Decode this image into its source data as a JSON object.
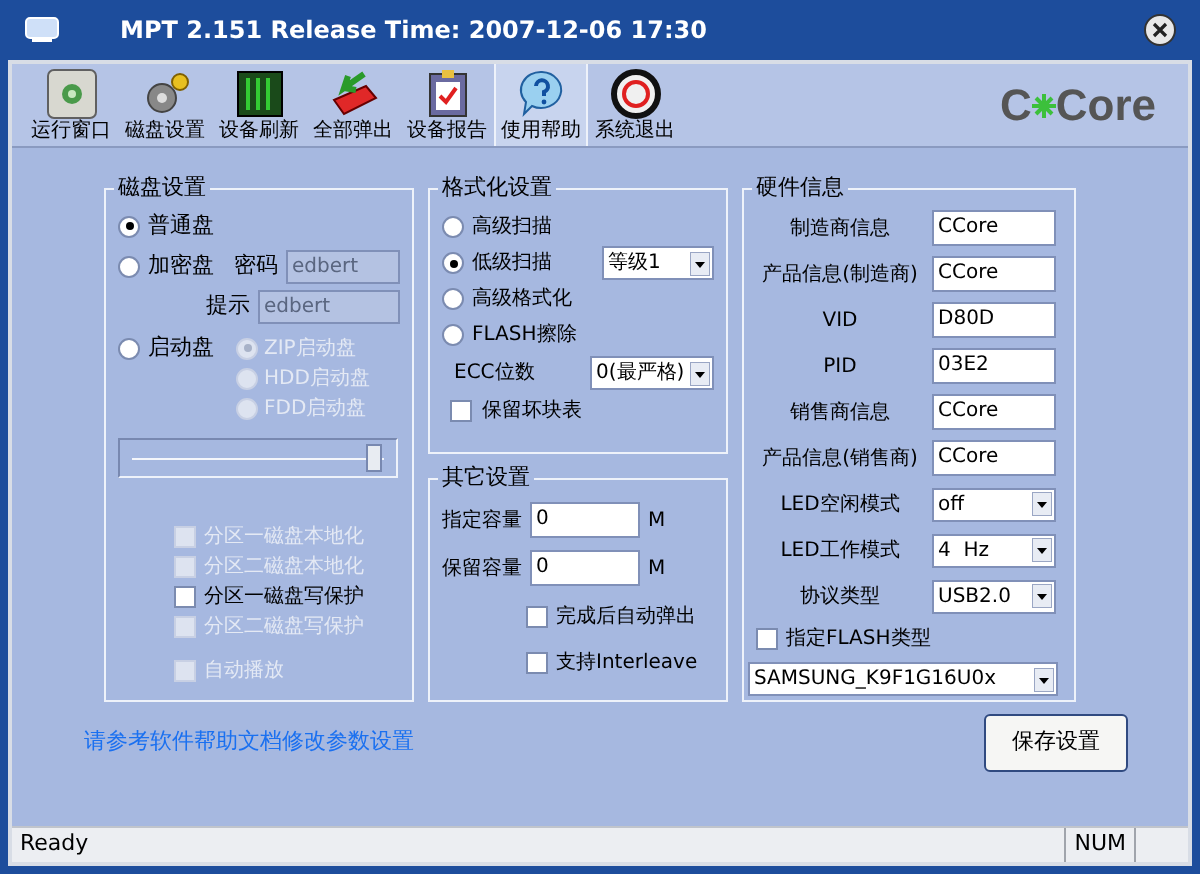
{
  "window": {
    "title": "MPT 2.151 Release Time: 2007-12-06 17:30"
  },
  "toolbar": {
    "items": [
      {
        "label": "运行窗口",
        "selected": false
      },
      {
        "label": "磁盘设置",
        "selected": false
      },
      {
        "label": "设备刷新",
        "selected": false
      },
      {
        "label": "全部弹出",
        "selected": false
      },
      {
        "label": "设备报告",
        "selected": false
      },
      {
        "label": "使用帮助",
        "selected": true
      },
      {
        "label": "系统退出",
        "selected": false
      }
    ]
  },
  "logo": {
    "part_1": "C",
    "part_2": "Core"
  },
  "disk_settings": {
    "title": "磁盘设置",
    "disk_types": [
      {
        "label": "普通盘",
        "selected": true
      },
      {
        "label": "加密盘",
        "selected": false
      }
    ],
    "password": {
      "label": "密码",
      "value": "edbert",
      "disabled": true
    },
    "hint": {
      "label": "提示",
      "value": "edbert",
      "disabled": true
    },
    "boot": {
      "label": "启动盘",
      "selected": false
    },
    "boot_types": [
      {
        "label": "ZIP启动盘",
        "selected": true,
        "disabled": true
      },
      {
        "label": "HDD启动盘",
        "selected": false,
        "disabled": true
      },
      {
        "label": "FDD启动盘",
        "selected": false,
        "disabled": true
      }
    ],
    "slider": {
      "level": 0.95
    },
    "checkboxes": [
      {
        "label": "分区一磁盘本地化",
        "checked": false,
        "disabled": true
      },
      {
        "label": "分区二磁盘本地化",
        "checked": false,
        "disabled": true
      },
      {
        "label": "分区一磁盘写保护",
        "checked": false,
        "disabled": false
      },
      {
        "label": "分区二磁盘写保护",
        "checked": false,
        "disabled": true
      }
    ],
    "autoplay": {
      "label": "自动播放",
      "checked": false,
      "disabled": true
    }
  },
  "format_settings": {
    "title": "格式化设置",
    "options": [
      {
        "label": "高级扫描",
        "selected": false
      },
      {
        "label": "低级扫描",
        "selected": true,
        "select": "等级1"
      },
      {
        "label": "高级格式化",
        "selected": false
      },
      {
        "label": "FLASH擦除",
        "selected": false
      }
    ],
    "ecc": {
      "label": "ECC位数",
      "value": "0(最严格)"
    },
    "keep_bad_blocks": {
      "label": "保留坏块表",
      "checked": false
    }
  },
  "other_settings": {
    "title": "其它设置",
    "fields": [
      {
        "label": "指定容量",
        "value": "0",
        "unit": "M"
      },
      {
        "label": "保留容量",
        "value": "0",
        "unit": "M"
      }
    ],
    "checkboxes": [
      {
        "label": "完成后自动弹出",
        "checked": false
      },
      {
        "label": "支持Interleave",
        "checked": false
      }
    ]
  },
  "hardware_info": {
    "title": "硬件信息",
    "fields": [
      {
        "kind": "text",
        "label": "制造商信息",
        "value": "CCore"
      },
      {
        "kind": "text",
        "label": "产品信息(制造商)",
        "value": "CCore"
      },
      {
        "kind": "text",
        "label": "VID",
        "value": "D80D"
      },
      {
        "kind": "text",
        "label": "PID",
        "value": "03E2"
      },
      {
        "kind": "text",
        "label": "销售商信息",
        "value": "CCore"
      },
      {
        "kind": "text",
        "label": "产品信息(销售商)",
        "value": "CCore"
      },
      {
        "kind": "select",
        "label": "LED空闲模式",
        "value": "off"
      },
      {
        "kind": "select",
        "label": "LED工作模式",
        "value": "4  Hz"
      },
      {
        "kind": "select",
        "label": "协议类型",
        "value": "USB2.0"
      }
    ],
    "flash_type": {
      "label": "指定FLASH类型",
      "checked": false
    },
    "flash_select": {
      "value": "SAMSUNG_K9F1G16U0x"
    }
  },
  "help_link": "请参考软件帮助文档修改参数设置",
  "save_button": "保存设置",
  "status_bar": {
    "text": "Ready",
    "num": "NUM"
  }
}
